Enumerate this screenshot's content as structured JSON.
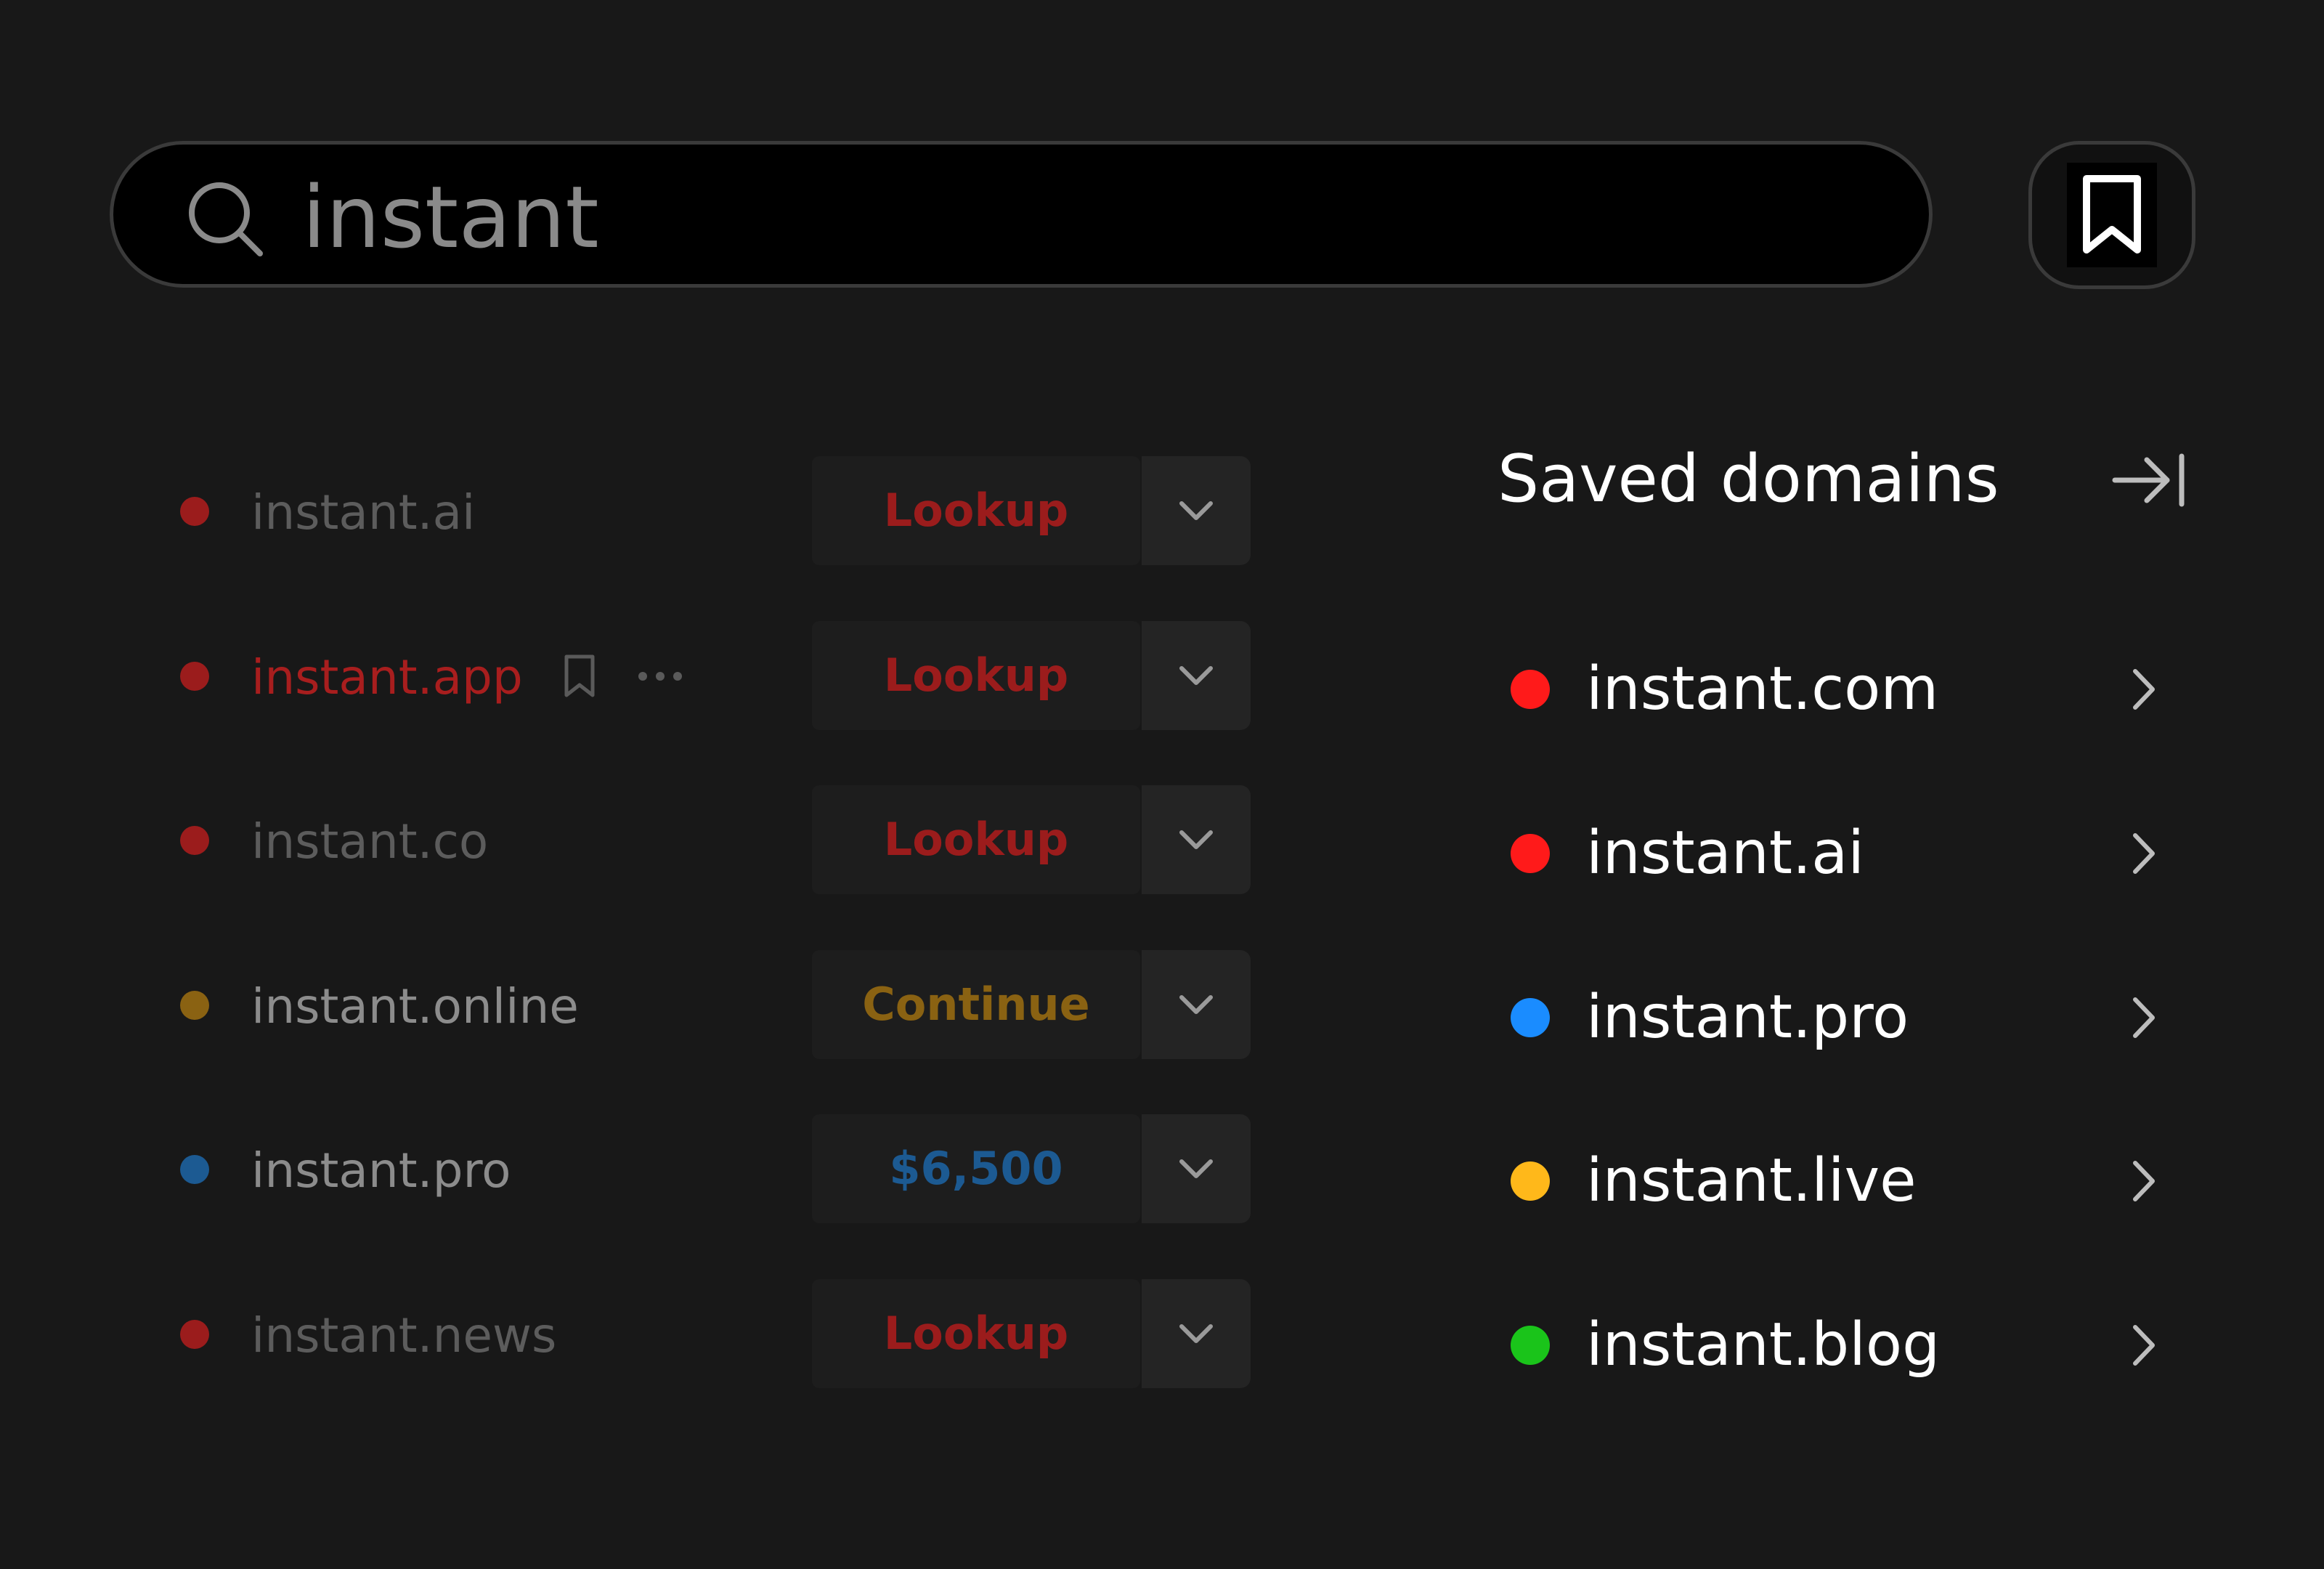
{
  "search": {
    "value": "instant",
    "icon": "search-icon"
  },
  "header": {
    "bookmark_icon": "bookmark-icon"
  },
  "results": [
    {
      "domain": "instant.ai",
      "status_color": "#9b1c1c",
      "domain_color": "#5c5c5c",
      "action": "Lookup",
      "action_color": "#9b1c1c",
      "show_actions": false
    },
    {
      "domain": "instant.app",
      "status_color": "#9b1c1c",
      "domain_color": "#a81e1e",
      "action": "Lookup",
      "action_color": "#9b1c1c",
      "show_actions": true
    },
    {
      "domain": "instant.co",
      "status_color": "#9b1c1c",
      "domain_color": "#5c5c5c",
      "action": "Lookup",
      "action_color": "#9b1c1c",
      "show_actions": false
    },
    {
      "domain": "instant.online",
      "status_color": "#8a6212",
      "domain_color": "#8c8c8c",
      "action": "Continue",
      "action_color": "#8a6212",
      "show_actions": false
    },
    {
      "domain": "instant.pro",
      "status_color": "#1c5a92",
      "domain_color": "#8c8c8c",
      "action": "$6,500",
      "action_color": "#1c5a92",
      "show_actions": false
    },
    {
      "domain": "instant.news",
      "status_color": "#9b1c1c",
      "domain_color": "#5c5c5c",
      "action": "Lookup",
      "action_color": "#9b1c1c",
      "show_actions": false
    }
  ],
  "saved": {
    "title": "Saved domains",
    "collapse_icon": "collapse-panel-icon",
    "items": [
      {
        "domain": "instant.com",
        "color": "#ff1a1a"
      },
      {
        "domain": "instant.ai",
        "color": "#ff1a1a"
      },
      {
        "domain": "instant.pro",
        "color": "#1a8cff"
      },
      {
        "domain": "instant.live",
        "color": "#ffb81a"
      },
      {
        "domain": "instant.blog",
        "color": "#1ac41a"
      }
    ]
  },
  "colors": {
    "background": "#181818",
    "search_background": "#000000",
    "border": "#3a3a3a",
    "lookup": "#9b1c1c",
    "continue": "#8a6212",
    "price": "#1c5a92"
  }
}
